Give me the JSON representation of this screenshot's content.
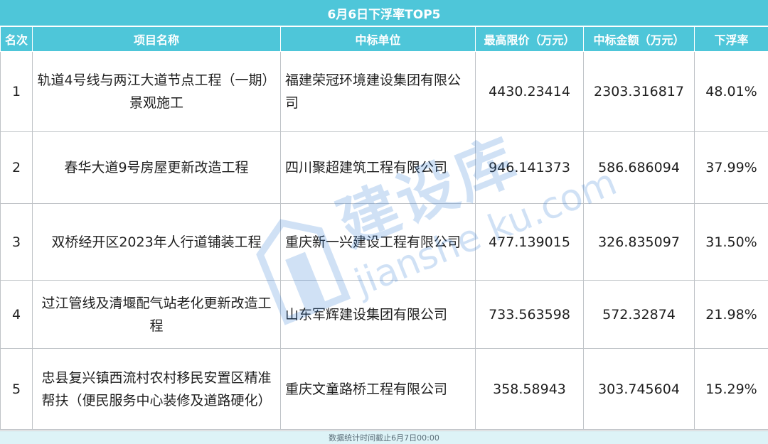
{
  "title": "6月6日下浮率TOP5",
  "columns": [
    "名次",
    "项目名称",
    "中标单位",
    "最高限价（万元）",
    "中标金额（万元）",
    "下浮率"
  ],
  "rows": [
    {
      "rank": "1",
      "project": "轨道4号线与两江大道节点工程（一期）景观施工",
      "company": "福建荣冠环境建设集团有限公司",
      "max_price": "4430.23414",
      "bid_amount": "2303.316817",
      "rate": "48.01%"
    },
    {
      "rank": "2",
      "project": "春华大道9号房屋更新改造工程",
      "company": "四川聚超建筑工程有限公司",
      "max_price": "946.141373",
      "bid_amount": "586.686094",
      "rate": "37.99%"
    },
    {
      "rank": "3",
      "project": "双桥经开区2023年人行道铺装工程",
      "company": "重庆新一兴建设工程有限公司",
      "max_price": "477.139015",
      "bid_amount": "326.835097",
      "rate": "31.50%"
    },
    {
      "rank": "4",
      "project": "过江管线及清堰配气站老化更新改造工程",
      "company": "山东军辉建设集团有限公司",
      "max_price": "733.563598",
      "bid_amount": "572.32874",
      "rate": "21.98%"
    },
    {
      "rank": "5",
      "project": "忠县复兴镇西流村农村移民安置区精准帮扶（便民服务中心装修及道路硬化）",
      "company": "重庆文童路桥工程有限公司",
      "max_price": "358.58943",
      "bid_amount": "303.745604",
      "rate": "15.29%"
    }
  ],
  "footer": "数据统计时间截止6月7日00:00",
  "watermark": {
    "brand": "建设库",
    "domain": "jianshe ku.com",
    "color": "#2d7bd6"
  },
  "colors": {
    "header": "#4ec6d9",
    "footer": "#ddf3f7",
    "border": "#bfc3c7"
  }
}
